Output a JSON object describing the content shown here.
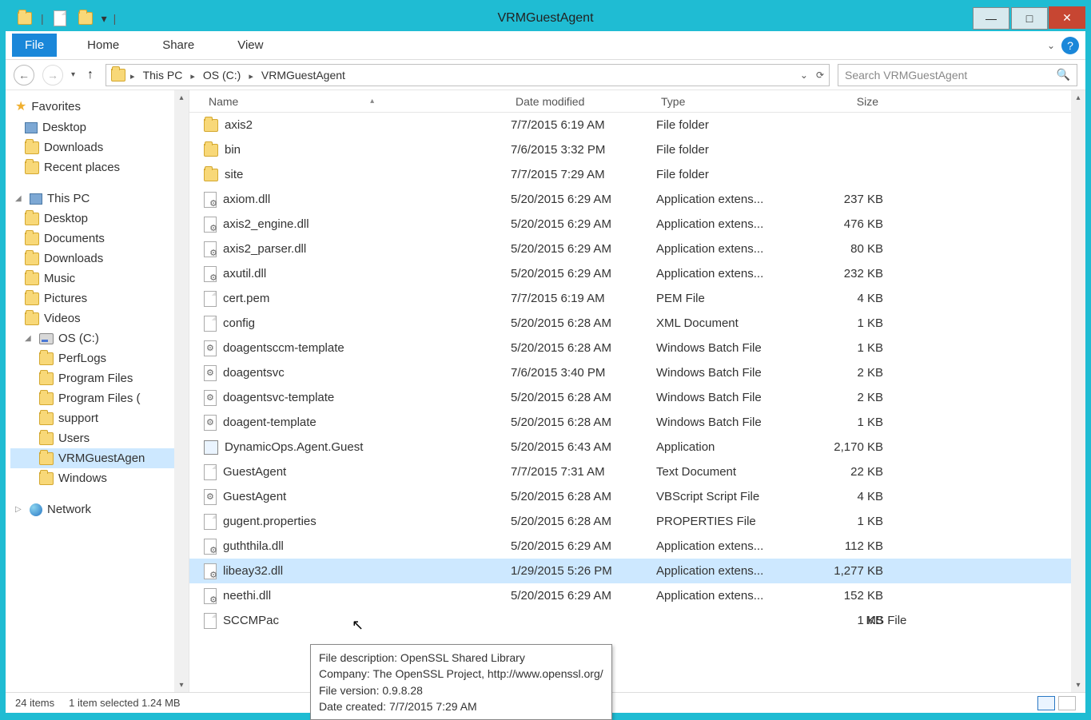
{
  "window": {
    "title": "VRMGuestAgent"
  },
  "ribbon": {
    "file": "File",
    "home": "Home",
    "share": "Share",
    "view": "View"
  },
  "breadcrumbs": {
    "c0": "This PC",
    "c1": "OS (C:)",
    "c2": "VRMGuestAgent"
  },
  "search": {
    "placeholder": "Search VRMGuestAgent"
  },
  "tree": {
    "favorites": {
      "label": "Favorites",
      "items": {
        "i0": "Desktop",
        "i1": "Downloads",
        "i2": "Recent places"
      }
    },
    "thispc": {
      "label": "This PC",
      "items": {
        "i0": "Desktop",
        "i1": "Documents",
        "i2": "Downloads",
        "i3": "Music",
        "i4": "Pictures",
        "i5": "Videos"
      },
      "drive": {
        "label": "OS (C:)",
        "folders": {
          "f0": "PerfLogs",
          "f1": "Program Files",
          "f2": "Program Files (",
          "f3": "support",
          "f4": "Users",
          "f5": "VRMGuestAgen",
          "f6": "Windows"
        }
      }
    },
    "network": {
      "label": "Network"
    }
  },
  "cols": {
    "name": "Name",
    "mod": "Date modified",
    "type": "Type",
    "size": "Size"
  },
  "rows": [
    {
      "ic": "folder",
      "name": "axis2",
      "mod": "7/7/2015 6:19 AM",
      "type": "File folder",
      "size": ""
    },
    {
      "ic": "folder",
      "name": "bin",
      "mod": "7/6/2015 3:32 PM",
      "type": "File folder",
      "size": ""
    },
    {
      "ic": "folder",
      "name": "site",
      "mod": "7/7/2015 7:29 AM",
      "type": "File folder",
      "size": ""
    },
    {
      "ic": "dll",
      "name": "axiom.dll",
      "mod": "5/20/2015 6:29 AM",
      "type": "Application extens...",
      "size": "237 KB"
    },
    {
      "ic": "dll",
      "name": "axis2_engine.dll",
      "mod": "5/20/2015 6:29 AM",
      "type": "Application extens...",
      "size": "476 KB"
    },
    {
      "ic": "dll",
      "name": "axis2_parser.dll",
      "mod": "5/20/2015 6:29 AM",
      "type": "Application extens...",
      "size": "80 KB"
    },
    {
      "ic": "dll",
      "name": "axutil.dll",
      "mod": "5/20/2015 6:29 AM",
      "type": "Application extens...",
      "size": "232 KB"
    },
    {
      "ic": "file",
      "name": "cert.pem",
      "mod": "7/7/2015 6:19 AM",
      "type": "PEM File",
      "size": "4 KB"
    },
    {
      "ic": "file",
      "name": "config",
      "mod": "5/20/2015 6:28 AM",
      "type": "XML Document",
      "size": "1 KB"
    },
    {
      "ic": "bat",
      "name": "doagentsccm-template",
      "mod": "5/20/2015 6:28 AM",
      "type": "Windows Batch File",
      "size": "1 KB"
    },
    {
      "ic": "bat",
      "name": "doagentsvc",
      "mod": "7/6/2015 3:40 PM",
      "type": "Windows Batch File",
      "size": "2 KB"
    },
    {
      "ic": "bat",
      "name": "doagentsvc-template",
      "mod": "5/20/2015 6:28 AM",
      "type": "Windows Batch File",
      "size": "2 KB"
    },
    {
      "ic": "bat",
      "name": "doagent-template",
      "mod": "5/20/2015 6:28 AM",
      "type": "Windows Batch File",
      "size": "1 KB"
    },
    {
      "ic": "exe",
      "name": "DynamicOps.Agent.Guest",
      "mod": "5/20/2015 6:43 AM",
      "type": "Application",
      "size": "2,170 KB"
    },
    {
      "ic": "file",
      "name": "GuestAgent",
      "mod": "7/7/2015 7:31 AM",
      "type": "Text Document",
      "size": "22 KB"
    },
    {
      "ic": "bat",
      "name": "GuestAgent",
      "mod": "5/20/2015 6:28 AM",
      "type": "VBScript Script File",
      "size": "4 KB"
    },
    {
      "ic": "file",
      "name": "gugent.properties",
      "mod": "5/20/2015 6:28 AM",
      "type": "PROPERTIES File",
      "size": "1 KB"
    },
    {
      "ic": "dll",
      "name": "guththila.dll",
      "mod": "5/20/2015 6:29 AM",
      "type": "Application extens...",
      "size": "112 KB"
    },
    {
      "ic": "dll",
      "name": "libeay32.dll",
      "mod": "1/29/2015 5:26 PM",
      "type": "Application extens...",
      "size": "1,277 KB",
      "sel": true
    },
    {
      "ic": "dll",
      "name": "neethi.dll",
      "mod": "5/20/2015 6:29 AM",
      "type": "Application extens...",
      "size": "152 KB"
    },
    {
      "ic": "file",
      "name": "SCCMPac",
      "mod": "",
      "type": "                                                               MS File",
      "size": "1 KB"
    }
  ],
  "status": {
    "count": "24 items",
    "sel": "1 item selected 1.24 MB"
  },
  "tooltip": {
    "l1": "File description: OpenSSL Shared Library",
    "l2": "Company: The OpenSSL Project, http://www.openssl.org/",
    "l3": "File version: 0.9.8.28",
    "l4": "Date created: 7/7/2015 7:29 AM"
  }
}
